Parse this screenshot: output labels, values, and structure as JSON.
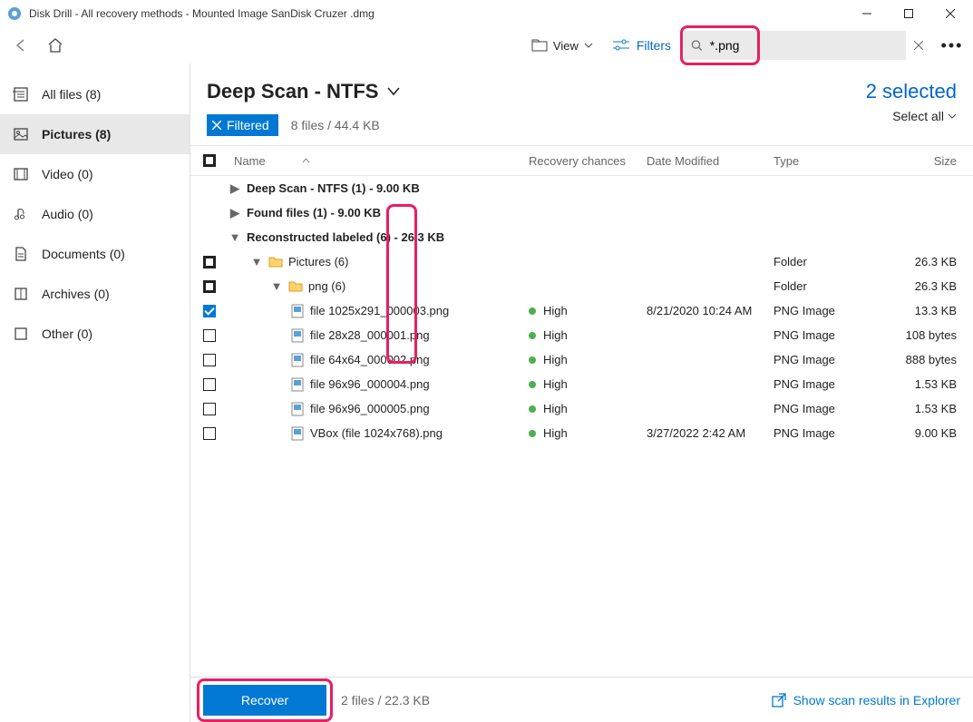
{
  "window": {
    "title": "Disk Drill - All recovery methods - Mounted Image SanDisk Cruzer .dmg"
  },
  "toolbar": {
    "view_label": "View",
    "filters_label": "Filters",
    "search_value": "*.png"
  },
  "sidebar": {
    "items": [
      {
        "icon": "files",
        "label": "All files (8)"
      },
      {
        "icon": "pictures",
        "label": "Pictures (8)"
      },
      {
        "icon": "video",
        "label": "Video (0)"
      },
      {
        "icon": "audio",
        "label": "Audio (0)"
      },
      {
        "icon": "documents",
        "label": "Documents (0)"
      },
      {
        "icon": "archives",
        "label": "Archives (0)"
      },
      {
        "icon": "other",
        "label": "Other (0)"
      }
    ],
    "active_index": 1
  },
  "header": {
    "scan_title": "Deep Scan - NTFS",
    "filtered_label": "Filtered",
    "summary": "8 files / 44.4 KB",
    "selected_label": "2 selected",
    "select_all_label": "Select all"
  },
  "columns": {
    "name": "Name",
    "chances": "Recovery chances",
    "date": "Date Modified",
    "type": "Type",
    "size": "Size"
  },
  "groups": [
    {
      "expanded": false,
      "label": "Deep Scan - NTFS (1) - 9.00 KB"
    },
    {
      "expanded": false,
      "label": "Found files (1) - 9.00 KB"
    },
    {
      "expanded": true,
      "label": "Reconstructed labeled (6) - 26.3 KB"
    }
  ],
  "folders": [
    {
      "indent": 1,
      "check": "partial",
      "label": "Pictures (6)",
      "type": "Folder",
      "size": "26.3 KB"
    },
    {
      "indent": 2,
      "check": "partial",
      "label": "png (6)",
      "type": "Folder",
      "size": "26.3 KB"
    }
  ],
  "files": [
    {
      "check": "checked",
      "name": "file 1025x291_000003.png",
      "chance": "High",
      "date": "8/21/2020 10:24 AM",
      "type": "PNG Image",
      "size": "13.3 KB"
    },
    {
      "check": "none",
      "name": "file 28x28_000001.png",
      "chance": "High",
      "date": "",
      "type": "PNG Image",
      "size": "108 bytes"
    },
    {
      "check": "none",
      "name": "file 64x64_000002.png",
      "chance": "High",
      "date": "",
      "type": "PNG Image",
      "size": "888 bytes"
    },
    {
      "check": "none",
      "name": "file 96x96_000004.png",
      "chance": "High",
      "date": "",
      "type": "PNG Image",
      "size": "1.53 KB"
    },
    {
      "check": "none",
      "name": "file 96x96_000005.png",
      "chance": "High",
      "date": "",
      "type": "PNG Image",
      "size": "1.53 KB"
    },
    {
      "check": "none",
      "name": "VBox (file 1024x768).png",
      "chance": "High",
      "date": "3/27/2022 2:42 AM",
      "type": "PNG Image",
      "size": "9.00 KB"
    }
  ],
  "footer": {
    "recover_label": "Recover",
    "summary": "2 files / 22.3 KB",
    "explorer_label": "Show scan results in Explorer"
  }
}
